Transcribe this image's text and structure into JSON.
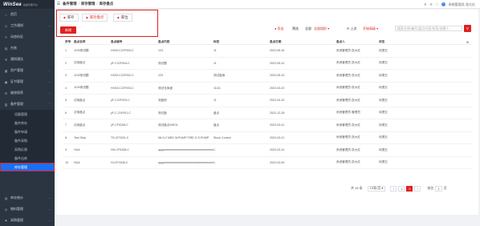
{
  "brand": {
    "logo": "WinSea",
    "subtitle": "船舶管理平台"
  },
  "sidebar": {
    "items": [
      {
        "icon": "⌂",
        "label": "首页",
        "arrow": ""
      },
      {
        "icon": "◷",
        "label": "工作通知",
        "arrow": "⌄"
      },
      {
        "icon": "✎",
        "label": "动态执证",
        "arrow": ""
      },
      {
        "icon": "▤",
        "label": "台账",
        "arrow": ""
      },
      {
        "icon": "☰",
        "label": "通知通告",
        "arrow": ""
      },
      {
        "icon": "▦",
        "label": "资产管理",
        "arrow": "⌄"
      },
      {
        "icon": "▣",
        "label": "证书管理",
        "arrow": "⌄"
      },
      {
        "icon": "⚙",
        "label": "维修保养",
        "arrow": "⌄"
      },
      {
        "icon": "▥",
        "label": "备件管理",
        "arrow": "⌃"
      }
    ],
    "sub_items": [
      "设备管理",
      "备件库存",
      "备件申请",
      "备件采购",
      "采购反馈",
      "备件出库",
      "库存管理"
    ],
    "lower_items": [
      {
        "icon": "▤",
        "label": "库存统计",
        "arrow": "⌄"
      },
      {
        "icon": "◎",
        "label": "物料管理",
        "arrow": "⌄"
      },
      {
        "icon": "⚑",
        "label": "采购管理",
        "arrow": "⌄"
      }
    ]
  },
  "topbar": {
    "hamburger": "☰",
    "breadcrumb": [
      "备件管理",
      "库存管理",
      "库存盘点"
    ],
    "right": [
      "⚲",
      "⟳",
      "⛶"
    ],
    "user": "系统管理员-张大红"
  },
  "tabs": [
    {
      "label": "库存"
    },
    {
      "label": "库存盘点"
    },
    {
      "label": "库位"
    }
  ],
  "new_button": "新增",
  "toolbar": {
    "export": "● 导出",
    "filter_label": "筛选",
    "all_label": "全部",
    "all_value": "全部组织 ▾",
    "query": "⟳ 上次",
    "advanced": "开始高级 ▾",
    "search_placeholder": "搜索名称/编号/盘点内容/标签/创建人 ...",
    "search_icon": "⚲"
  },
  "table": {
    "headers": [
      "序号",
      "盘点名称",
      "盘点编号",
      "盘点内容",
      "标签",
      "盘点日期",
      "盘点人",
      "状态",
      "⚙"
    ],
    "rows": [
      [
        "1",
        "1100测试题",
        "HX03-C22F003-C",
        "123",
        "11",
        "2022-05-16",
        "系统管理员-张大红",
        "待提交"
      ],
      [
        "2",
        "试用盘点",
        "yF-C22F004-C",
        "测试题",
        "11",
        "2022-05-10",
        "系统管理员-张大红",
        "待提交"
      ],
      [
        "3",
        "1100测试题",
        "HX03-C22F002-C",
        "123",
        "测试盘库",
        "2022-05-10",
        "系统管理员-张大红",
        "待提交"
      ],
      [
        "4",
        "1100测试题",
        "HX03-C22F003-C",
        "测试仓库盘",
        "11111",
        "2022-04-20",
        "系统管理员-张大红",
        "待提交"
      ],
      [
        "5",
        "试用盘点",
        "yF-C22F003-C",
        "测盘到",
        "11",
        "2022-04-15",
        "系统管理员-张大红",
        "待提交"
      ],
      [
        "6",
        "试用盘点",
        "yF-C-21F001-C",
        "测试盘",
        "盘点",
        "2021-12-28",
        "系统管理员-管理员",
        "待提交"
      ],
      [
        "7",
        "试用盘点",
        "yF-CF0208-C",
        "测试盘点WEOL",
        "盘点",
        "2022-03-21",
        "系统管理员-张大红",
        "待提交"
      ],
      [
        "8",
        "Test Ship",
        "TS-CF0201-C",
        "WLS-2 MED W.PUMP FIRE G.S.PUMP",
        "Stock Control",
        "2022-03-21",
        "系统管理员-张大红",
        "待提交"
      ],
      [
        "9",
        "HUA",
        "HH-CF0208-C",
        "qqqweeeeeeeeeeeeeeeeeeeeeeeeeeeeeeeeeeeeeeeeeeee",
        "1",
        "2022-03-10",
        "系统管理员-张大红",
        "待提交"
      ],
      [
        "10",
        "HUA",
        "HI-CF0208-C",
        "qqqweeeeeeeeeeeeeeeeeeeeeeeeeeeeeeeeeeeeeeeeeeee",
        "1",
        "2022-03-09",
        "系统管理员-张大红",
        "待提交"
      ]
    ]
  },
  "pagination": {
    "total": "共 16 条",
    "page_size": "10条/页 ▾",
    "prev": "‹",
    "pages": [
      "1",
      "2"
    ],
    "current": "2",
    "next": "›",
    "goto_label": "前往",
    "goto_value": "1",
    "goto_suffix": "页"
  },
  "colors": {
    "accent": "#e02020",
    "sidebar": "#2b3441",
    "active": "#1d6ff2"
  }
}
